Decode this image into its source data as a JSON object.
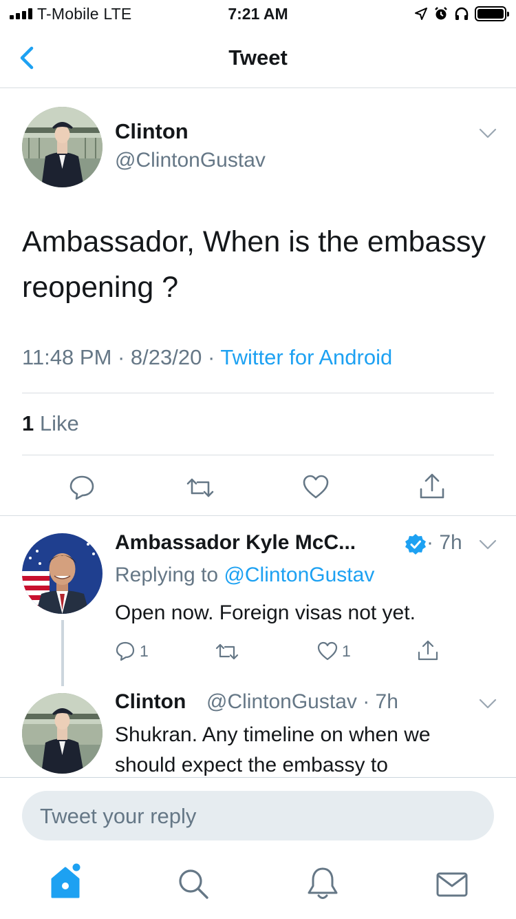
{
  "status_bar": {
    "carrier": "T-Mobile  LTE",
    "time": "7:21 AM"
  },
  "nav": {
    "back_icon": "chevron-left-icon",
    "title": "Tweet"
  },
  "main_tweet": {
    "name": "Clinton",
    "handle": "@ClintonGustav",
    "text": "Ambassador, When is the embassy reopening ?",
    "time": "11:48 PM · 8/23/20 · ",
    "source": "Twitter for Android",
    "like_count": "1",
    "like_label": " Like"
  },
  "replies": [
    {
      "name": "Ambassador Kyle McC...",
      "time": " · 7h",
      "replying_prefix": "Replying to ",
      "replying_handle": "@ClintonGustav",
      "text": "Open now. Foreign visas not yet.",
      "reply_count": "1",
      "like_count": "1"
    },
    {
      "name": "Clinton",
      "handle_time": "@ClintonGustav · 7h",
      "text_line1": "Shukran. Any timeline on when we",
      "text_line2": "should expect the embassy to"
    }
  ],
  "reply_box": {
    "placeholder": "Tweet your reply"
  },
  "colors": {
    "accent": "#1da1f2",
    "muted": "#657786",
    "border": "#d8dde2"
  }
}
